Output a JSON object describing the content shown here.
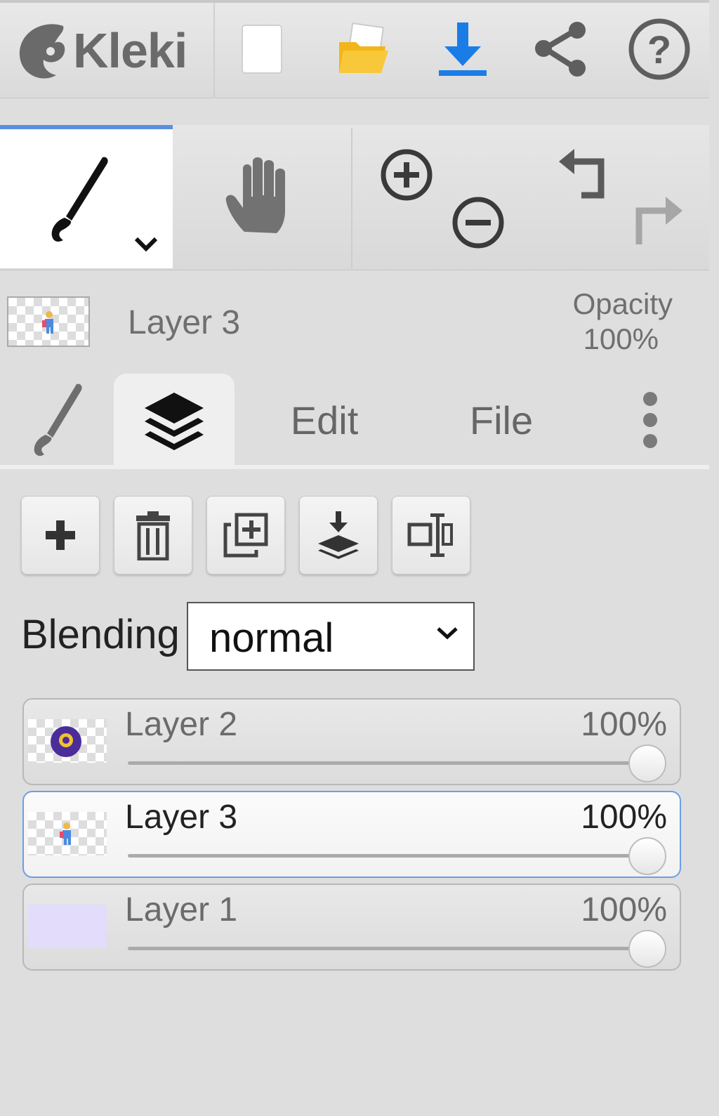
{
  "app": {
    "name": "Kleki"
  },
  "topbar": {
    "buttons": [
      {
        "name": "new-image",
        "icon": "blank-page-icon"
      },
      {
        "name": "open-image",
        "icon": "folder-icon"
      },
      {
        "name": "save-image",
        "icon": "download-icon"
      },
      {
        "name": "share",
        "icon": "share-icon"
      },
      {
        "name": "help",
        "icon": "help-icon"
      }
    ]
  },
  "tools": {
    "active": "brush",
    "items": [
      "brush",
      "hand",
      "zoom-in",
      "zoom-out",
      "undo",
      "redo"
    ]
  },
  "current_layer": {
    "name": "Layer 3",
    "opacity_label": "Opacity",
    "opacity_value": "100%"
  },
  "tabs": [
    {
      "id": "brush",
      "icon": "brush-icon",
      "label": ""
    },
    {
      "id": "layers",
      "icon": "layers-icon",
      "label": "",
      "active": true
    },
    {
      "id": "edit",
      "label": "Edit"
    },
    {
      "id": "file",
      "label": "File"
    },
    {
      "id": "more",
      "icon": "kebab-menu-icon",
      "label": ""
    }
  ],
  "layer_actions": [
    "add-layer",
    "delete-layer",
    "duplicate-layer",
    "merge-down",
    "rename-layer"
  ],
  "blending": {
    "label": "Blending",
    "value": "normal"
  },
  "layers": [
    {
      "name": "Layer 2",
      "opacity": "100%",
      "opacity_fraction": 1.0,
      "selected": false
    },
    {
      "name": "Layer 3",
      "opacity": "100%",
      "opacity_fraction": 1.0,
      "selected": true
    },
    {
      "name": "Layer 1",
      "opacity": "100%",
      "opacity_fraction": 1.0,
      "selected": false
    }
  ],
  "colors": {
    "accent": "#5a8fe0",
    "download": "#1a7de6",
    "folder": "#f2b619",
    "layer1_fill": "#e3dcfb"
  }
}
